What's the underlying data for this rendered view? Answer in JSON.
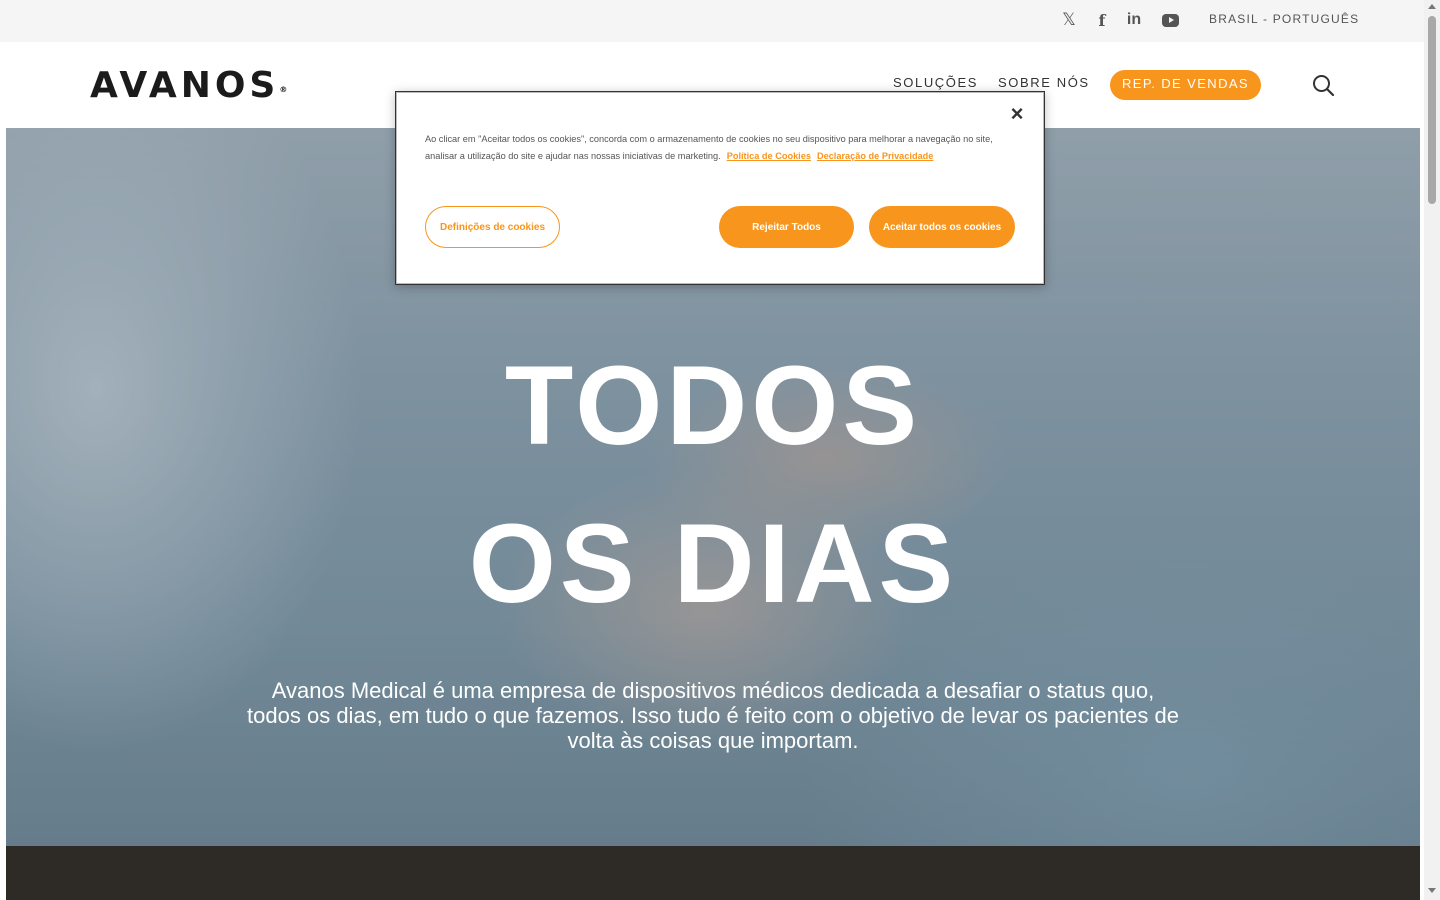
{
  "topbar": {
    "social": [
      {
        "name": "x",
        "glyph": "𝕏"
      },
      {
        "name": "facebook",
        "glyph": "f"
      },
      {
        "name": "linkedin",
        "glyph": "in"
      },
      {
        "name": "youtube",
        "glyph": ""
      }
    ],
    "language": "BRASIL - PORTUGUÊS"
  },
  "header": {
    "logo": "AVANOS",
    "logo_mark": "®",
    "nav": {
      "solucoes": "SOLUÇÕES",
      "sobre": "SOBRE NÓS",
      "rep": "REP. DE VENDAS"
    }
  },
  "hero": {
    "title_line1": "TODOS",
    "title_line2": "OS DIAS",
    "text": "Avanos Medical é uma empresa de dispositivos médicos dedicada a desafiar o status quo, todos os dias, em tudo o que fazemos. Isso tudo é feito com o objetivo de levar os pacientes de volta às coisas que importam."
  },
  "cookie": {
    "close": "×",
    "text": "Ao clicar em \"Aceitar todos os cookies\", concorda com o armazenamento de cookies no seu dispositivo para melhorar a navegação no site, analisar a utilização do site e ajudar nas nossas iniciativas de marketing.",
    "link_cookies": "Política de Cookies",
    "link_privacy": "Declaração de Privacidade",
    "settings_button": "Definições de cookies",
    "reject_button": "Rejeitar Todos",
    "accept_button": "Aceitar todos os cookies"
  },
  "colors": {
    "accent": "#f8951d",
    "dark_band": "#2e2a26"
  }
}
